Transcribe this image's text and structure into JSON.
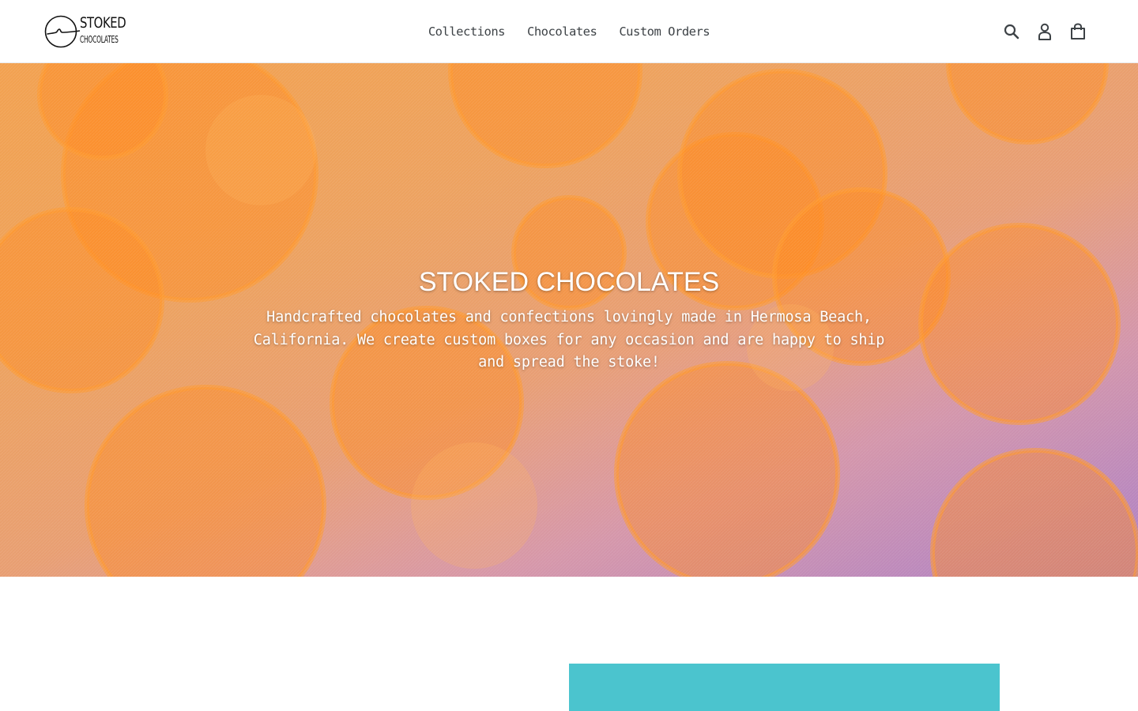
{
  "brand": {
    "logo_line_1": "STOKED",
    "logo_line_2": "CHOCOLATES"
  },
  "nav": {
    "items": [
      {
        "label": "Collections"
      },
      {
        "label": "Chocolates"
      },
      {
        "label": "Custom Orders"
      }
    ]
  },
  "header_icons": {
    "search": "search-icon",
    "account": "account-icon",
    "cart": "cart-icon"
  },
  "hero": {
    "title": "STOKED CHOCOLATES",
    "text": "Handcrafted chocolates and confections lovingly made in Hermosa Beach, California. We create custom boxes for any occasion and are happy to ship and spread the stoke!"
  },
  "colors": {
    "text": "#3d4246",
    "feature_block": "#4bc4ce",
    "hero_orange": "#f29a3c",
    "hero_purple": "#b487c4"
  }
}
